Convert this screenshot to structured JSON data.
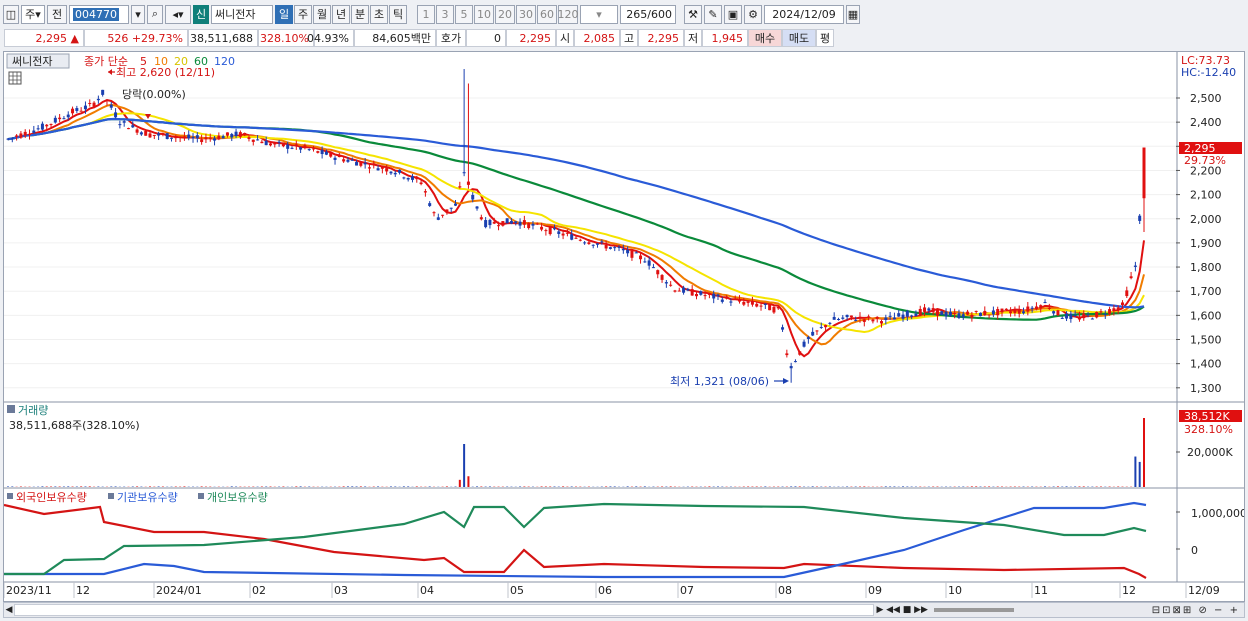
{
  "toolbar": {
    "period_type": "주",
    "prev_label": "전",
    "code": "004770",
    "stock_name": "써니전자",
    "new_label": "신",
    "tabs": [
      "일",
      "주",
      "월",
      "년",
      "분",
      "초",
      "틱"
    ],
    "active_tab": "일",
    "intervals": [
      "1",
      "3",
      "5",
      "10",
      "20",
      "30",
      "60",
      "120"
    ],
    "count": "265",
    "count_max": "/600",
    "date": "2024/12/09"
  },
  "quote": {
    "price": "2,295",
    "change": "526",
    "change_pct": "+29.73%",
    "volume": "38,511,688",
    "volume_pct": "328.10%",
    "turnover": "04.93%",
    "amount": "84,605백만",
    "hoga_label": "호가",
    "hoga_value": "0",
    "hoga_price": "2,295",
    "open_label": "시",
    "open": "2,085",
    "high_label": "고",
    "high": "2,295",
    "low_label": "저",
    "low": "1,945",
    "buy_label": "매수",
    "sell_label": "매도",
    "eval_label": "평"
  },
  "price_panel": {
    "stock_label": "써니전자",
    "ma_title": "종가 단순",
    "ma_periods": [
      "5",
      "10",
      "20",
      "60",
      "120"
    ],
    "ma_colors": [
      "#e01010",
      "#f07c00",
      "#f5e400",
      "#0a8a3a",
      "#2a5bd7"
    ],
    "high_annotation": "최고 2,620 (12/11)",
    "low_annotation": "최저 1,321 (08/06)",
    "drop_annotation": "당락(0.00%)",
    "lc_label": "LC:73.73",
    "hc_label": "HC:-12.40",
    "current_price_tag": "2,295",
    "current_pct_tag": "29.73%",
    "yticks": [
      "2,500",
      "2,400",
      "2,300",
      "2,200",
      "2,100",
      "2,000",
      "1,900",
      "1,800",
      "1,700",
      "1,600",
      "1,500",
      "1,400",
      "1,300"
    ]
  },
  "volume_panel": {
    "title": "거래량",
    "info": "38,511,688주(328.10%)",
    "tag_value": "38,512K",
    "tag_pct": "328.10%",
    "ytick": "20,000K"
  },
  "holding_panel": {
    "legend": [
      "외국인보유수량",
      "기관보유수량",
      "개인보유수량"
    ],
    "legend_colors": [
      "#d41414",
      "#2a5bd7",
      "#1f8a5a"
    ],
    "yticks": [
      "1,000,000",
      "0"
    ]
  },
  "x_axis": [
    "2023/11",
    "12",
    "2024/01",
    "02",
    "03",
    "04",
    "05",
    "06",
    "07",
    "08",
    "09",
    "10",
    "11",
    "12",
    "12/09"
  ],
  "colors": {
    "up": "#e01010",
    "down": "#1a3fb0",
    "tag_bg": "#e01010"
  }
}
